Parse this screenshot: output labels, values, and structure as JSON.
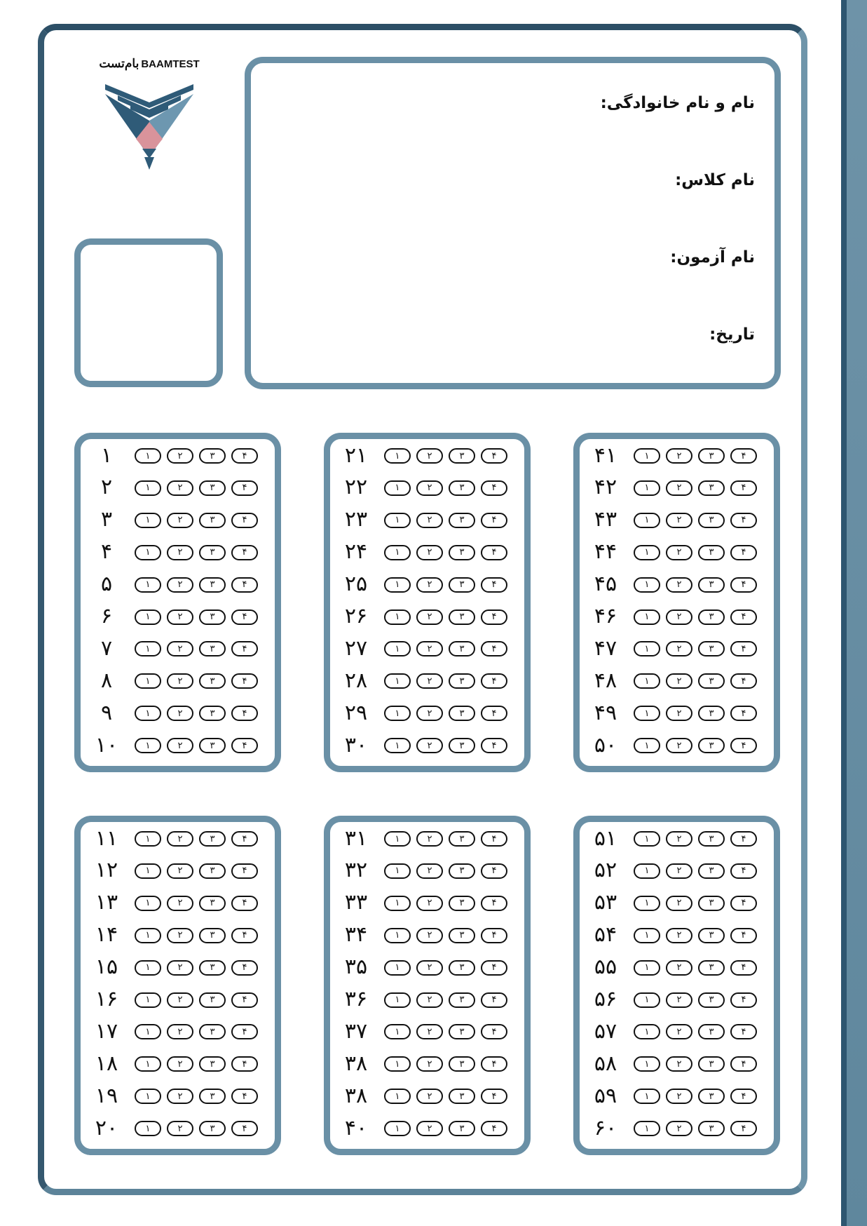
{
  "brand": {
    "latin": "BAAMTEST",
    "persian": "بام‌تست"
  },
  "info": {
    "name_label": "نام و نام خانوادگی:",
    "class_label": "نام کلاس:",
    "exam_label": "نام آزمون:",
    "date_label": "تاریخ:"
  },
  "options": [
    "۱",
    "۲",
    "۳",
    "۴"
  ],
  "panels": [
    {
      "questions": [
        "۱",
        "۲",
        "۳",
        "۴",
        "۵",
        "۶",
        "۷",
        "۸",
        "۹",
        "۱۰"
      ]
    },
    {
      "questions": [
        "۲۱",
        "۲۲",
        "۲۳",
        "۲۴",
        "۲۵",
        "۲۶",
        "۲۷",
        "۲۸",
        "۲۹",
        "۳۰"
      ]
    },
    {
      "questions": [
        "۴۱",
        "۴۲",
        "۴۳",
        "۴۴",
        "۴۵",
        "۴۶",
        "۴۷",
        "۴۸",
        "۴۹",
        "۵۰"
      ]
    },
    {
      "questions": [
        "۱۱",
        "۱۲",
        "۱۳",
        "۱۴",
        "۱۵",
        "۱۶",
        "۱۷",
        "۱۸",
        "۱۹",
        "۲۰"
      ]
    },
    {
      "questions": [
        "۳۱",
        "۳۲",
        "۳۳",
        "۳۴",
        "۳۵",
        "۳۶",
        "۳۷",
        "۳۸",
        "۳۸",
        "۴۰"
      ]
    },
    {
      "questions": [
        "۵۱",
        "۵۲",
        "۵۳",
        "۵۴",
        "۵۵",
        "۵۶",
        "۵۷",
        "۵۸",
        "۵۹",
        "۶۰"
      ]
    }
  ],
  "colors": {
    "frame": "#4d7891",
    "box_border": "#6a90a6",
    "logo_dark": "#2f5b78",
    "logo_light": "#6d97b0",
    "logo_pink": "#d9939b"
  }
}
